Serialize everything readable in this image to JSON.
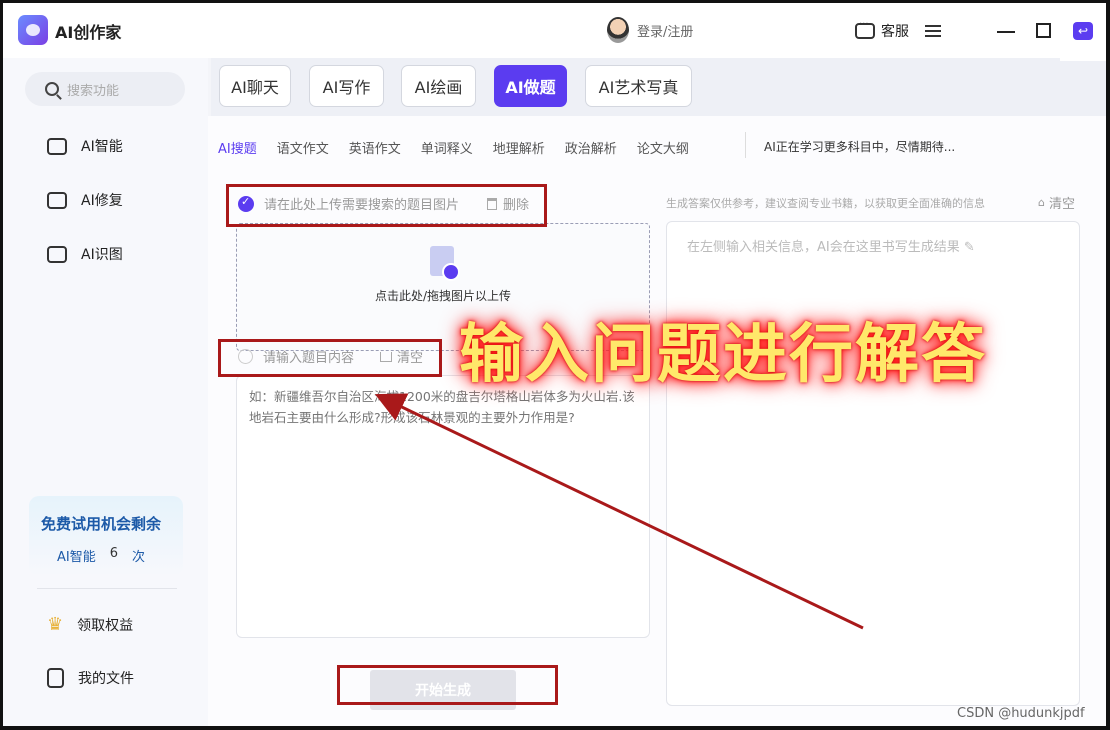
{
  "app": {
    "title": "AI创作家",
    "user_label": "登录/注册",
    "service_label": "客服"
  },
  "sidebar": {
    "search_placeholder": "搜索功能",
    "items": [
      {
        "label": "AI智能",
        "icon": "ai-chip-icon"
      },
      {
        "label": "AI修复",
        "icon": "repair-icon"
      },
      {
        "label": "AI识图",
        "icon": "image-icon"
      }
    ],
    "trial": {
      "title": "免费试用机会剩余",
      "feature": "AI智能",
      "count": "6",
      "unit": "次"
    },
    "bottom_items": [
      {
        "label": "领取权益",
        "icon": "crown-icon"
      },
      {
        "label": "我的文件",
        "icon": "file-icon"
      }
    ]
  },
  "tabs": [
    {
      "label": "AI聊天"
    },
    {
      "label": "AI写作"
    },
    {
      "label": "AI绘画"
    },
    {
      "label": "AI做题",
      "active": true
    },
    {
      "label": "AI艺术写真"
    }
  ],
  "subtabs": [
    {
      "label": "AI搜题",
      "active": true
    },
    {
      "label": "语文作文"
    },
    {
      "label": "英语作文"
    },
    {
      "label": "单词释义"
    },
    {
      "label": "地理解析"
    },
    {
      "label": "政治解析"
    },
    {
      "label": "论文大纲"
    }
  ],
  "subtab_note": "AI正在学习更多科目中，尽情期待...",
  "upload": {
    "label": "请在此处上传需要搜索的题目图片",
    "delete_label": "删除",
    "drop_text": "点击此处/拖拽图片以上传"
  },
  "question": {
    "label": "请输入题目内容",
    "clear_label": "清空",
    "placeholder": "如：新疆维吾尔自治区海拔1200米的盘吉尔塔格山岩体多为火山岩.该地岩石主要由什么形成?形成该石林景观的主要外力作用是?"
  },
  "generate_label": "开始生成",
  "result": {
    "note": "生成答案仅供参考，建议查阅专业书籍，以获取更全面准确的信息",
    "clear_label": "清空",
    "placeholder": "在左侧输入相关信息，AI会在这里书写生成结果 ✎"
  },
  "annotation_text": "输入问题进行解答",
  "watermark": "CSDN @hudunkjpdf",
  "colors": {
    "accent": "#5b3cf0",
    "annotation_red": "#a9191a",
    "annotation_text": "#ffe86a"
  }
}
